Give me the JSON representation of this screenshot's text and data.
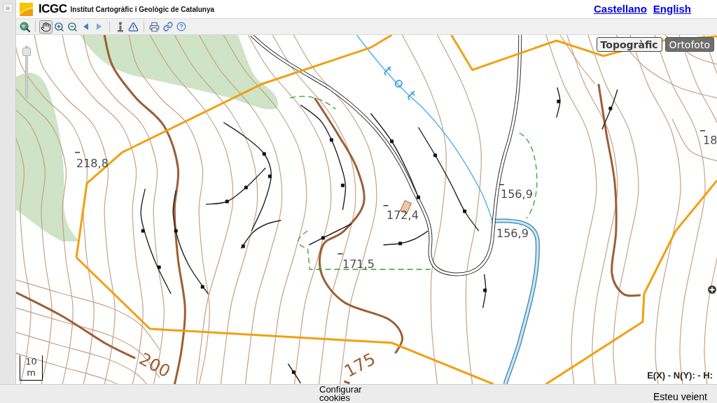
{
  "sidebar_toggle": {
    "label": "»"
  },
  "header": {
    "logo_text": "ICGC",
    "title": "Institut Cartogràfic i Geològic de Catalunya",
    "languages": [
      {
        "label": "Castellano"
      },
      {
        "label": "English"
      }
    ]
  },
  "toolbar": [
    [
      {
        "kind": "globe",
        "selected": false
      }
    ],
    [
      {
        "kind": "pan",
        "selected": true
      },
      {
        "kind": "zoom_in",
        "selected": false
      },
      {
        "kind": "zoom_out",
        "selected": false
      },
      {
        "kind": "back",
        "selected": false
      },
      {
        "kind": "forward",
        "selected": false
      }
    ],
    [
      {
        "kind": "info",
        "selected": false
      },
      {
        "kind": "warning",
        "selected": false
      }
    ],
    [
      {
        "kind": "print",
        "selected": false
      },
      {
        "kind": "link",
        "selected": false
      },
      {
        "kind": "help",
        "selected": false
      }
    ]
  ],
  "map": {
    "zoom_slider": {
      "level": 0.95
    },
    "base_layers": [
      {
        "label": "Topogràfic",
        "selected": true
      },
      {
        "label": "Ortofoto",
        "selected": false
      }
    ],
    "labels": [
      {
        "kind": "spot_height",
        "text": "218,8"
      },
      {
        "kind": "spot_height",
        "text": "172,4"
      },
      {
        "kind": "spot_height",
        "text": "171,5"
      },
      {
        "kind": "spot_height",
        "text": "156,9"
      },
      {
        "kind": "spot_height",
        "text": "156,9"
      },
      {
        "kind": "spot_height",
        "text": "18"
      },
      {
        "kind": "contour",
        "text": "200"
      },
      {
        "kind": "contour",
        "text": "175"
      },
      {
        "kind": "water",
        "text": "t o t"
      }
    ],
    "scale_bar": "10 m",
    "coordinates": "E(X) - N(Y): - H:"
  },
  "footer": {
    "cookies_link": "Configurar cookies",
    "status": "Esteu veient"
  }
}
